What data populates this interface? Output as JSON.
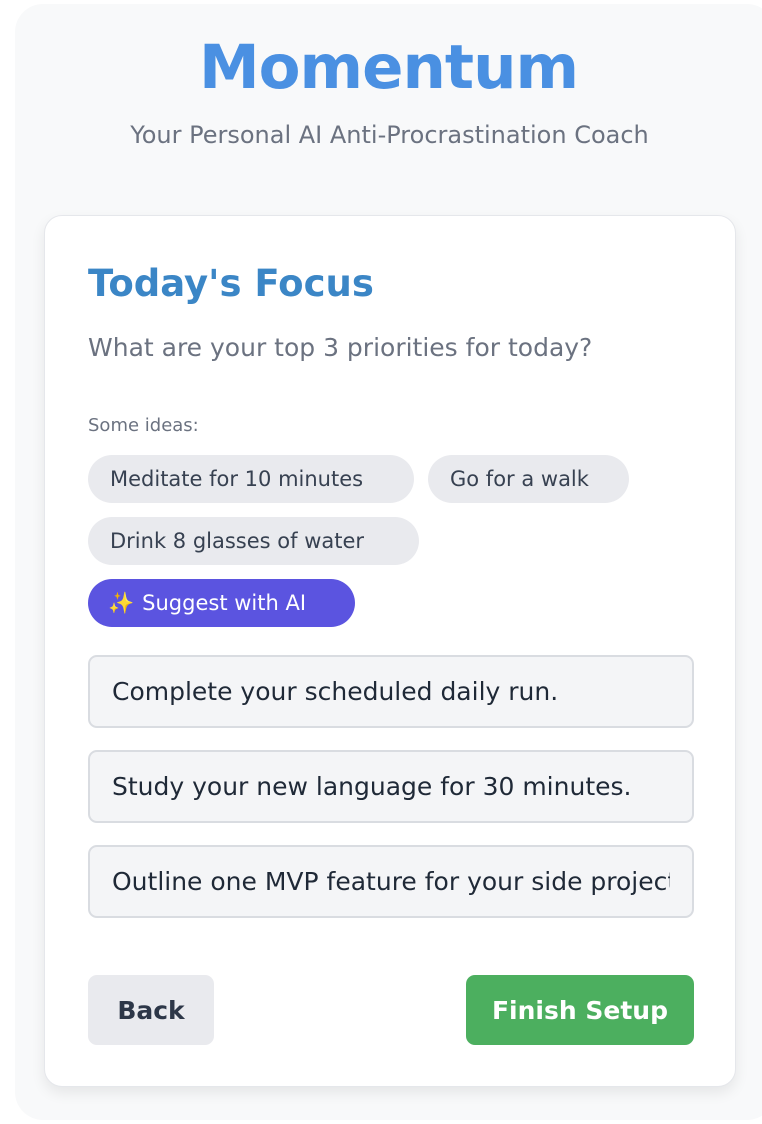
{
  "app": {
    "title": "Momentum",
    "subtitle": "Your Personal AI Anti-Procrastination Coach"
  },
  "card": {
    "title": "Today's Focus",
    "question": "What are your top 3 priorities for today?",
    "ideas_label": "Some ideas:",
    "ideas": [
      "Meditate for 10 minutes",
      "Go for a walk",
      "Drink 8 glasses of water"
    ],
    "ai_button": {
      "icon": "sparkles-icon",
      "label": "Suggest with AI"
    },
    "priorities": [
      "Complete your scheduled daily run.",
      "Study your new language for 30 minutes.",
      "Outline one MVP feature for your side project."
    ],
    "back_label": "Back",
    "finish_label": "Finish Setup"
  },
  "colors": {
    "brand": "#4a90e2",
    "ai_button": "#5b54e0",
    "finish_button": "#4caf5f"
  }
}
